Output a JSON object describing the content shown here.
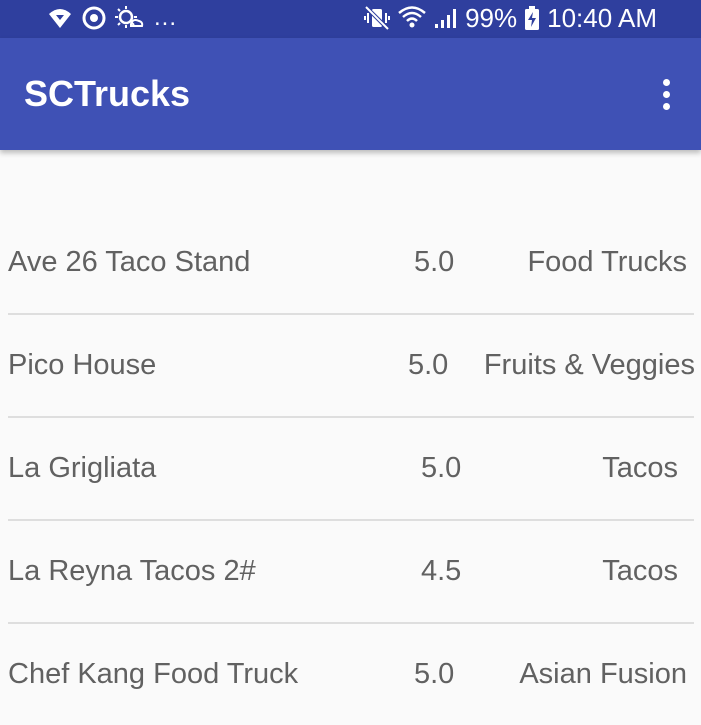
{
  "status_bar": {
    "left_icons": [
      "wifi-call-icon",
      "data-saver-icon",
      "weather-icon"
    ],
    "more_indicator": "...",
    "right_icons": [
      "mute-vibrate-icon",
      "wifi-icon",
      "signal-icon"
    ],
    "battery": "99%",
    "time": "10:40 AM"
  },
  "app_bar": {
    "title": "SCTrucks",
    "menu_icon": "more-vert-icon",
    "color": "#3f51b5",
    "status_color": "#2f3f9e"
  },
  "trucks": [
    {
      "name": "Ave 26 Taco Stand",
      "rating": "5.0",
      "category": "Food Trucks"
    },
    {
      "name": "Pico House",
      "rating": "5.0",
      "category": "Fruits & Veggies"
    },
    {
      "name": "La Grigliata",
      "rating": "5.0",
      "category": "Tacos"
    },
    {
      "name": "La Reyna Tacos 2#",
      "rating": "4.5",
      "category": "Tacos"
    },
    {
      "name": "Chef Kang Food Truck",
      "rating": "5.0",
      "category": "Asian Fusion"
    }
  ]
}
